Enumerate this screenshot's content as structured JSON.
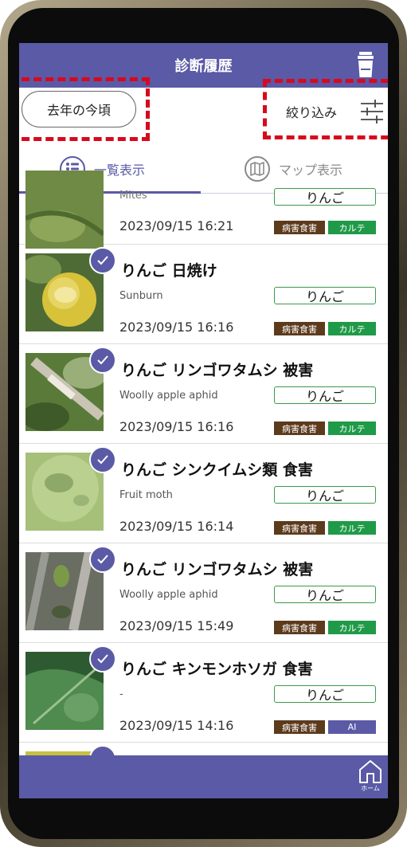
{
  "header": {
    "title": "診断履歴"
  },
  "filters": {
    "last_year_label": "去年の今頃",
    "filter_label": "絞り込み"
  },
  "tabs": [
    {
      "label": "一覧表示",
      "selected": true
    },
    {
      "label": "マップ表示",
      "selected": false
    }
  ],
  "entries": [
    {
      "title": "",
      "subtitle": "Mites",
      "crop": "りんご",
      "date": "2023/09/15 16:21",
      "category": "病害食害",
      "tag": "カルテ",
      "checked": false
    },
    {
      "title": "りんご 日焼け",
      "subtitle": "Sunburn",
      "crop": "りんご",
      "date": "2023/09/15 16:16",
      "category": "病害食害",
      "tag": "カルテ",
      "checked": true
    },
    {
      "title": "りんご リンゴワタムシ 被害",
      "subtitle": "Woolly apple aphid",
      "crop": "りんご",
      "date": "2023/09/15 16:16",
      "category": "病害食害",
      "tag": "カルテ",
      "checked": true
    },
    {
      "title": "りんご シンクイムシ類 食害",
      "subtitle": "Fruit moth",
      "crop": "りんご",
      "date": "2023/09/15 16:14",
      "category": "病害食害",
      "tag": "カルテ",
      "checked": true
    },
    {
      "title": "りんご リンゴワタムシ 被害",
      "subtitle": "Woolly apple aphid",
      "crop": "りんご",
      "date": "2023/09/15 15:49",
      "category": "病害食害",
      "tag": "カルテ",
      "checked": true
    },
    {
      "title": "りんご キンモンホソガ 食害",
      "subtitle": "-",
      "crop": "りんご",
      "date": "2023/09/15 14:16",
      "category": "病害食害",
      "tag": "AI",
      "checked": true
    }
  ],
  "bottom_nav": {
    "home_label": "ホーム"
  },
  "colors": {
    "accent": "#5a5aa6",
    "highlight": "#d7091d",
    "category_badge": "#5c3a1c",
    "karte_badge": "#1f9a48"
  }
}
